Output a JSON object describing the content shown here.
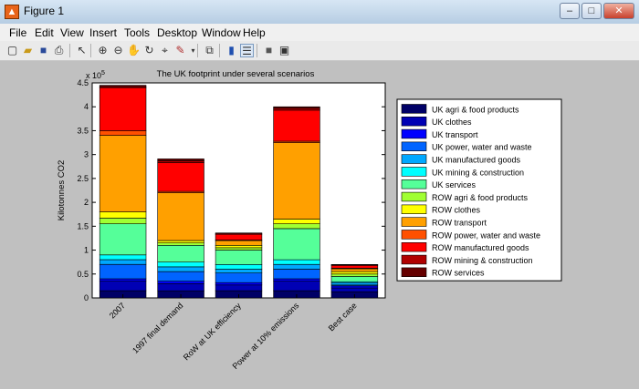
{
  "window": {
    "title": "Figure 1",
    "controls": [
      "–",
      "□",
      "✕"
    ]
  },
  "menu": [
    "File",
    "Edit",
    "View",
    "Insert",
    "Tools",
    "Desktop",
    "Window",
    "Help"
  ],
  "toolbar_icons": [
    "new-figure-icon",
    "open-file-icon",
    "save-icon",
    "print-icon",
    "pointer-icon",
    "zoom-in-icon",
    "zoom-out-icon",
    "pan-icon",
    "rotate-icon",
    "data-cursor-icon",
    "brush-icon",
    "link-plot-icon",
    "colorbar-icon",
    "legend-icon",
    "hide-plot-tools-icon",
    "show-plot-tools-icon"
  ],
  "chart_data": {
    "type": "bar",
    "stacked": true,
    "title": "The UK footprint under several scenarios",
    "ylabel": "Kilotonnes CO2",
    "xlabel": "",
    "y_multiplier": "x 10",
    "y_multiplier_exp": "5",
    "ylim": [
      0,
      4.5
    ],
    "yticks": [
      "0",
      "0.5",
      "1",
      "1.5",
      "2",
      "2.5",
      "3",
      "3.5",
      "4",
      "4.5"
    ],
    "categories": [
      "2007",
      "1997 final demand",
      "RoW at UK efficiency",
      "Power at 10% emissions",
      "Best case"
    ],
    "legend_position": "right",
    "series": [
      {
        "name": "UK agri & food products",
        "color": "#000066",
        "values": [
          0.15,
          0.15,
          0.15,
          0.15,
          0.13
        ]
      },
      {
        "name": "UK clothes",
        "color": "#0000b4",
        "values": [
          0.2,
          0.15,
          0.12,
          0.2,
          0.08
        ]
      },
      {
        "name": "UK transport",
        "color": "#0000ff",
        "values": [
          0.05,
          0.05,
          0.05,
          0.05,
          0.04
        ]
      },
      {
        "name": "UK power, water and waste",
        "color": "#0064ff",
        "values": [
          0.3,
          0.2,
          0.2,
          0.2,
          0.02
        ]
      },
      {
        "name": "UK manufactured goods",
        "color": "#00a8ff",
        "values": [
          0.1,
          0.1,
          0.08,
          0.1,
          0.05
        ]
      },
      {
        "name": "UK mining & construction",
        "color": "#00ffff",
        "values": [
          0.1,
          0.1,
          0.1,
          0.1,
          0.02
        ]
      },
      {
        "name": "UK services",
        "color": "#55ff99",
        "values": [
          0.65,
          0.35,
          0.3,
          0.65,
          0.11
        ]
      },
      {
        "name": "ROW agri & food products",
        "color": "#a0ff32",
        "values": [
          0.12,
          0.05,
          0.05,
          0.1,
          0.05
        ]
      },
      {
        "name": "ROW clothes",
        "color": "#ffff00",
        "values": [
          0.13,
          0.05,
          0.05,
          0.1,
          0.05
        ]
      },
      {
        "name": "ROW transport",
        "color": "#ffa000",
        "values": [
          1.6,
          1.0,
          0.1,
          1.6,
          0.06
        ]
      },
      {
        "name": "ROW power, water and waste",
        "color": "#ff5000",
        "values": [
          0.1,
          0.03,
          0.01,
          0.03,
          0.01
        ]
      },
      {
        "name": "ROW manufactured goods",
        "color": "#ff0000",
        "values": [
          0.9,
          0.6,
          0.12,
          0.65,
          0.06
        ]
      },
      {
        "name": "ROW mining & construction",
        "color": "#b00000",
        "values": [
          0.02,
          0.04,
          0.02,
          0.04,
          0.01
        ]
      },
      {
        "name": "ROW services",
        "color": "#660000",
        "values": [
          0.03,
          0.04,
          0.01,
          0.03,
          0.01
        ]
      }
    ]
  }
}
